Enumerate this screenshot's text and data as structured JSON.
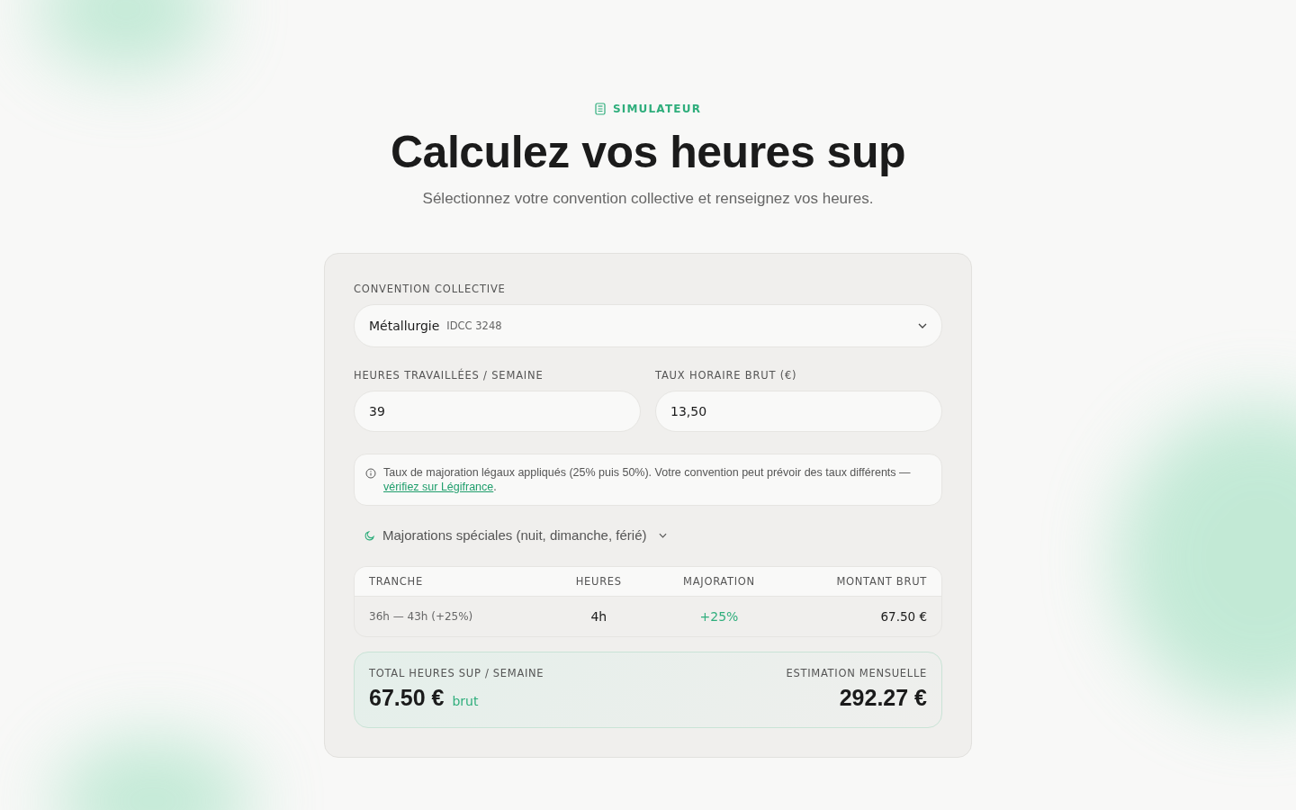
{
  "eyebrow": "SIMULATEUR",
  "title": "Calculez vos heures sup",
  "subtitle": "Sélectionnez votre convention collective et renseignez vos heures.",
  "convention": {
    "label": "CONVENTION COLLECTIVE",
    "value": "Métallurgie",
    "code": "IDCC 3248"
  },
  "fields": [
    {
      "label": "HEURES TRAVAILLÉES / SEMAINE",
      "value": "39"
    },
    {
      "label": "TAUX HORAIRE BRUT (€)",
      "value": "13,50"
    }
  ],
  "info": {
    "text": "Taux de majoration légaux appliqués (25% puis 50%). Votre convention peut prévoir des taux différents —",
    "link": "vérifiez sur Légifrance",
    "end": "."
  },
  "special": {
    "label": "Majorations spéciales (nuit, dimanche, férié)",
    "expanded": false
  },
  "table": {
    "columns": [
      "TRANCHE",
      "HEURES",
      "MAJORATION",
      "MONTANT BRUT"
    ],
    "rows": [
      [
        "36h — 43h (+25%)",
        "4h",
        "+25%",
        "67.50 €"
      ]
    ]
  },
  "total": {
    "label": "TOTAL HEURES SUP / SEMAINE",
    "value": "67.50 €",
    "unit": "brut",
    "monthly_label": "ESTIMATION MENSUELLE",
    "monthly_value": "292.27 €"
  }
}
